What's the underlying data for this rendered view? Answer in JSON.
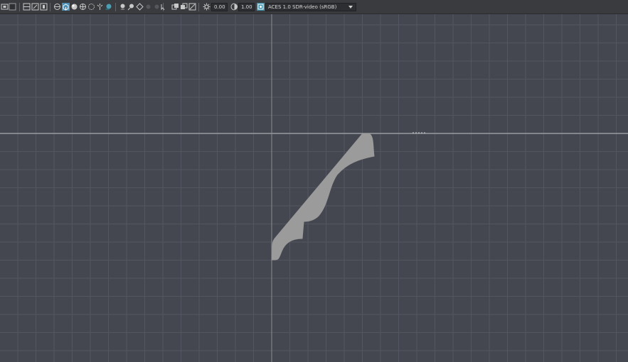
{
  "toolbar": {
    "icons": [
      "camera-icon",
      "select-mode-icon",
      "region-icon",
      "frame-all-icon",
      "frame-selected-icon",
      "layout-icon",
      "wireframe-icon",
      "smooth-shaded-icon",
      "shaded-icon",
      "textured-icon",
      "lights-icon",
      "shadows-icon",
      "ambient-occlusion-icon",
      "antialias-icon",
      "depth-of-field-icon",
      "motion-blur-icon",
      "hud-icon",
      "isolate-select-icon",
      "xray-icon",
      "xray-joints-icon",
      "backface-culling-icon",
      "grid-icon",
      "exposure-icon",
      "gamma-icon",
      "color-management-icon"
    ],
    "exposure_value": "0.00",
    "gamma_value": "1.00",
    "color_space": "ACES 1.0 SDR-video (sRGB)"
  },
  "viewport": {
    "background_color": "#444750",
    "grid_color": "#535660",
    "axis_color": "#9a9ca3",
    "shape_color": "#9b9b9b",
    "shape_name": "crown-molding-profile"
  }
}
